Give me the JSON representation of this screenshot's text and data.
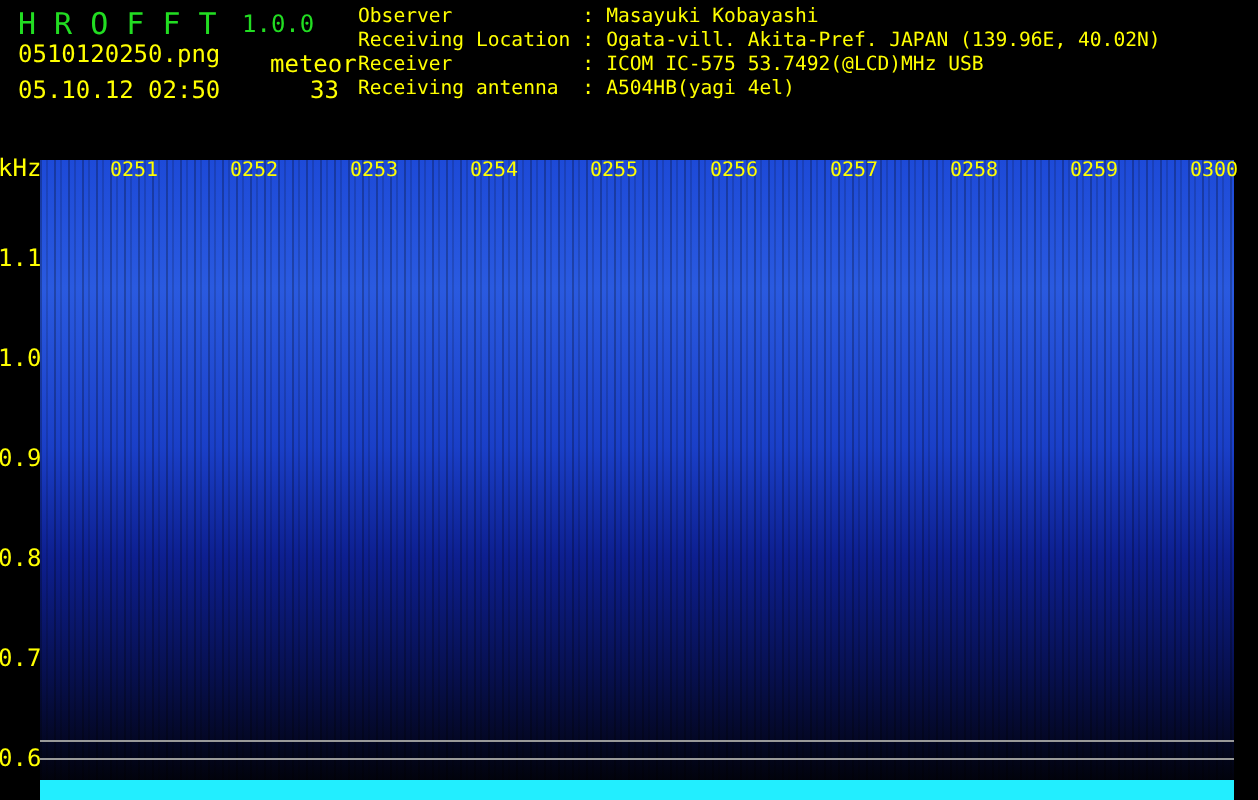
{
  "app": {
    "title": "H R O F F T",
    "version": "1.0.0"
  },
  "file": {
    "name": "0510120250.png",
    "datetime": "05.10.12 02:50"
  },
  "meteor": {
    "label": "meteor",
    "count": "33"
  },
  "info": {
    "separator": ":",
    "rows": [
      {
        "label": "Observer",
        "value": "Masayuki Kobayashi"
      },
      {
        "label": "Receiving Location",
        "value": "Ogata-vill. Akita-Pref. JAPAN (139.96E, 40.02N)"
      },
      {
        "label": "Receiver",
        "value": "ICOM IC-575 53.7492(@LCD)MHz USB"
      },
      {
        "label": "Receiving antenna",
        "value": "A504HB(yagi 4el)"
      }
    ]
  },
  "spectrogram": {
    "unit": "kHz",
    "y_labels": [
      "1.1",
      "1.0",
      "0.9",
      "0.8",
      "0.7",
      "0.6"
    ],
    "time_labels": [
      "0251",
      "0252",
      "0253",
      "0254",
      "0255",
      "0256",
      "0257",
      "0258",
      "0259",
      "0300"
    ]
  }
}
